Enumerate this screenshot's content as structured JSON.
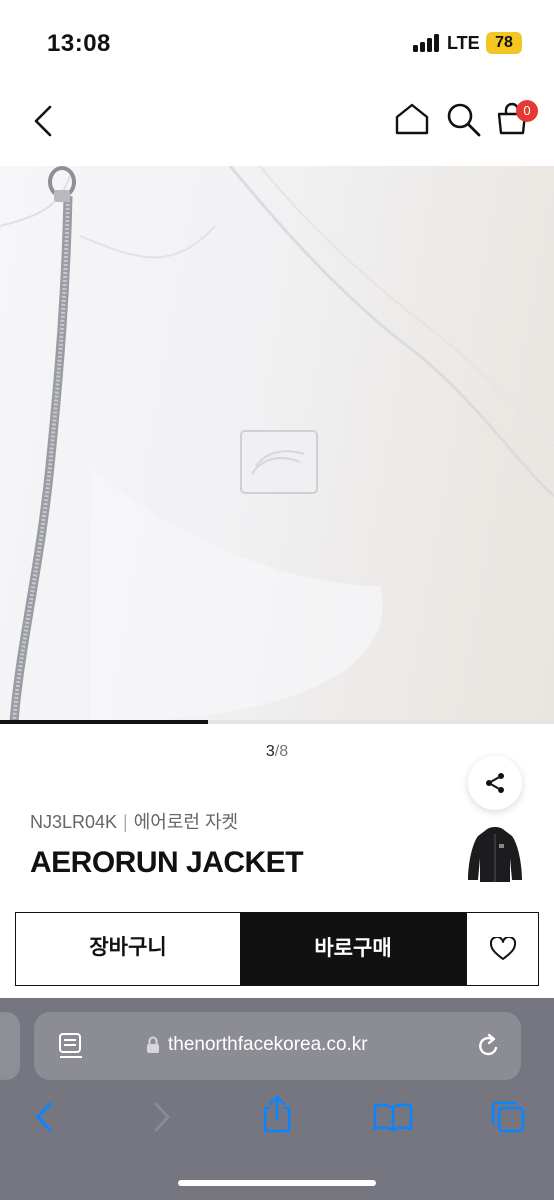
{
  "status": {
    "time": "13:08",
    "network": "LTE",
    "battery": "78"
  },
  "nav": {
    "cart_count": "0"
  },
  "gallery": {
    "current": "3",
    "separator": "/",
    "total": "8",
    "progress": 0.375
  },
  "product": {
    "code": "NJ3LR04K",
    "separator": "|",
    "name_ko": "에어로런 자켓",
    "title": "AERORUN JACKET"
  },
  "actions": {
    "cart_label": "장바구니",
    "buy_label": "바로구매"
  },
  "browser": {
    "url": "thenorthfacekorea.co.kr"
  },
  "colors": {
    "accent_badge": "#e53935",
    "battery": "#f3c623",
    "browser_tint": "#0a84ff"
  }
}
